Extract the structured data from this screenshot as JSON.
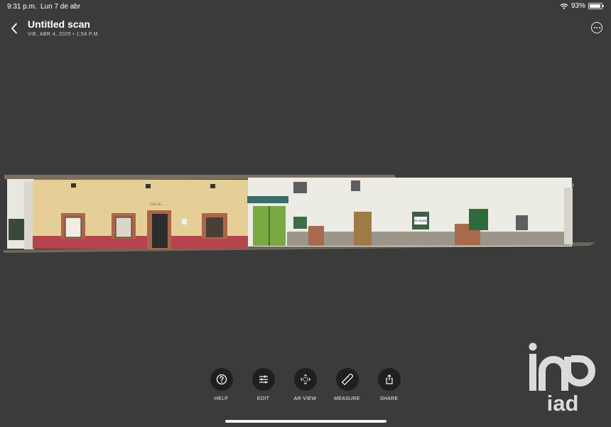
{
  "status_bar": {
    "time": "9:31 p.m.",
    "date": "Lun 7 de abr",
    "battery": "93%",
    "battery_level": 0.93
  },
  "header": {
    "title": "Untitled scan",
    "subtitle": "VIE, ABR 4, 2025 • 1:54 P.M."
  },
  "icons": {
    "back": "chevron-left-icon",
    "more": "ellipsis-circle-icon"
  },
  "toolbar": [
    {
      "label": "HELP",
      "icon": "question-circle-icon"
    },
    {
      "label": "EDIT",
      "icon": "sliders-icon"
    },
    {
      "label": "AR VIEW",
      "icon": "ar-cube-icon"
    },
    {
      "label": "MEASURE",
      "icon": "ruler-icon"
    },
    {
      "label": "SHARE",
      "icon": "share-icon"
    }
  ],
  "scan": {
    "sign_text": "CALLE .... ...",
    "shop_sign": "SE VENDE"
  },
  "watermark": {
    "text": "iad"
  },
  "colors": {
    "background": "#3b3b3b",
    "toolbar_button": "#1f1f1f",
    "facade_yellow": "#e8d29a",
    "facade_white": "#eceae2",
    "plinth_red": "#b8454b"
  }
}
